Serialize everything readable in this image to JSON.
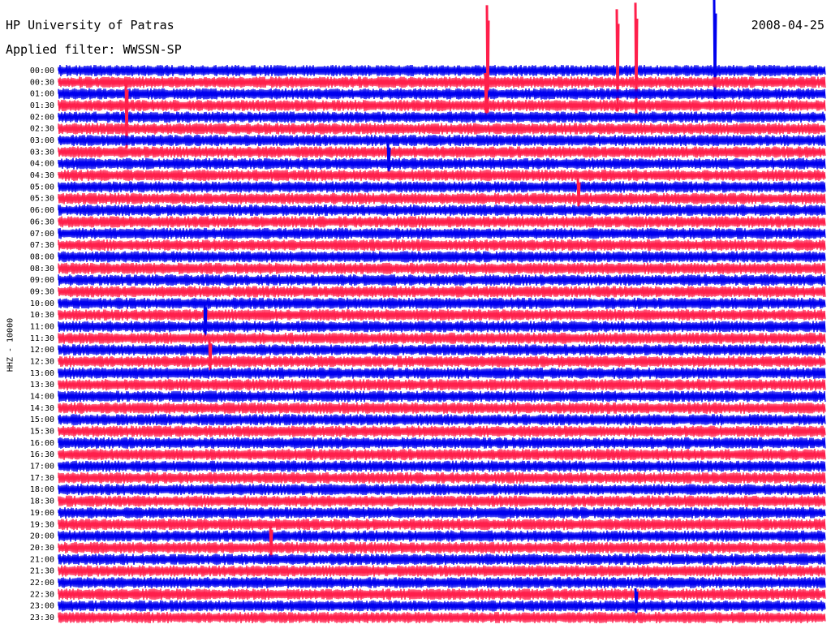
{
  "header": {
    "station": "HP University of Patras",
    "date": "2008-04-25",
    "filter": "Applied filter: WWSSN-SP"
  },
  "colors": {
    "trace_a": "#0000ee",
    "trace_b": "#ff1f4b",
    "background": "#ffffff"
  },
  "chart_data": {
    "type": "line",
    "title": "HP University of Patras",
    "ylabel": "HHZ - 10000",
    "rows": [
      "00:00",
      "00:30",
      "01:00",
      "01:30",
      "02:00",
      "02:30",
      "03:00",
      "03:30",
      "04:00",
      "04:30",
      "05:00",
      "05:30",
      "06:00",
      "06:30",
      "07:00",
      "07:30",
      "08:00",
      "08:30",
      "09:00",
      "09:30",
      "10:00",
      "10:30",
      "11:00",
      "11:30",
      "12:00",
      "12:30",
      "13:00",
      "13:30",
      "14:00",
      "14:30",
      "15:00",
      "15:30",
      "16:00",
      "16:30",
      "17:00",
      "17:30",
      "18:00",
      "18:30",
      "19:00",
      "19:30",
      "20:00",
      "20:30",
      "21:00",
      "21:30",
      "22:00",
      "22:30",
      "23:00",
      "23:30"
    ],
    "row_colors": [
      "trace_a",
      "trace_b"
    ],
    "grid": false,
    "legend": "none"
  }
}
